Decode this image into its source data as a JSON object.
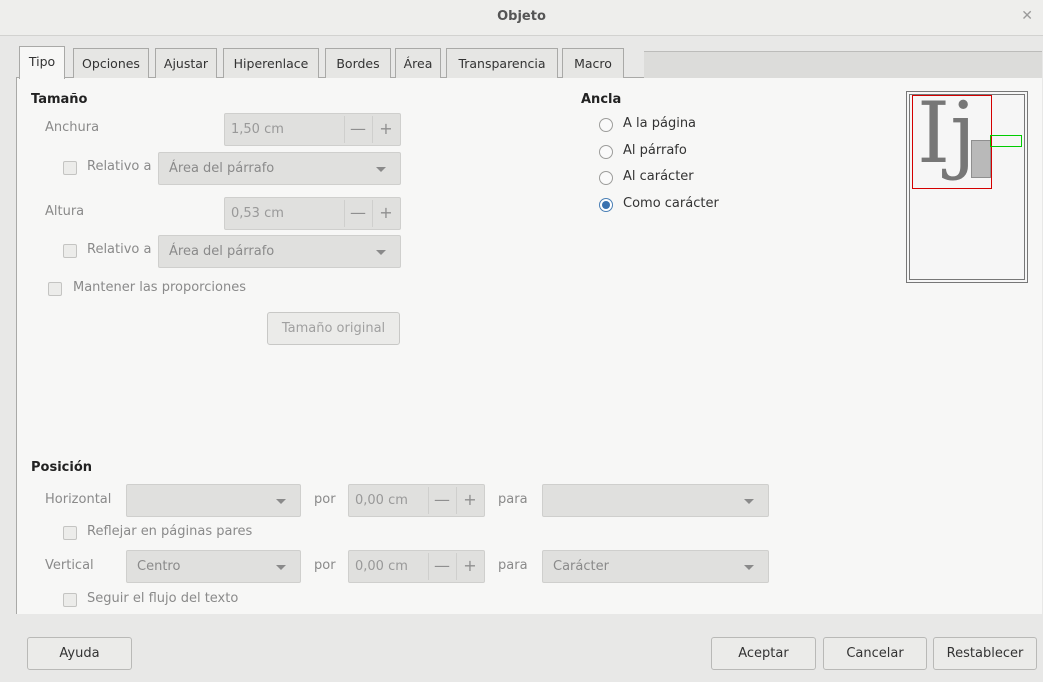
{
  "window": {
    "title": "Objeto"
  },
  "tabs": [
    "Tipo",
    "Opciones",
    "Ajustar",
    "Hiperenlace",
    "Bordes",
    "Área",
    "Transparencia",
    "Macro"
  ],
  "size": {
    "title": "Tamaño",
    "width_label": "Anchura",
    "width_value": "1,50 cm",
    "width_relative_label": "Relativo a",
    "width_relative_value": "Área del párrafo",
    "height_label": "Altura",
    "height_value": "0,53 cm",
    "height_relative_label": "Relativo a",
    "height_relative_value": "Área del párrafo",
    "keep_ratio_label": "Mantener las proporciones",
    "original_size_label": "Tamaño original"
  },
  "anchor": {
    "title": "Ancla",
    "options": [
      "A la página",
      "Al párrafo",
      "Al carácter",
      "Como carácter"
    ],
    "selected": "Como carácter"
  },
  "preview": {
    "glyph": "Ij"
  },
  "position": {
    "title": "Posición",
    "horizontal_label": "Horizontal",
    "horizontal_value": "",
    "by_label": "por",
    "horizontal_by_value": "0,00 cm",
    "to_label": "para",
    "horizontal_to_value": "",
    "mirror_label": "Reflejar en páginas pares",
    "vertical_label": "Vertical",
    "vertical_value": "Centro",
    "vertical_by_value": "0,00 cm",
    "vertical_to_value": "Carácter",
    "follow_flow_label": "Seguir el flujo del texto"
  },
  "footer": {
    "help_label": "Ayuda",
    "ok_label": "Aceptar",
    "cancel_label": "Cancelar",
    "reset_label": "Restablecer"
  },
  "icons": {
    "close": "close-icon",
    "minus": "minus-icon",
    "plus": "plus-icon",
    "dropdown": "chevron-down-icon"
  },
  "colors": {
    "radio_selected": "#3a72b0",
    "preview_frame": "#d40000",
    "preview_anchor": "#00cc00"
  }
}
